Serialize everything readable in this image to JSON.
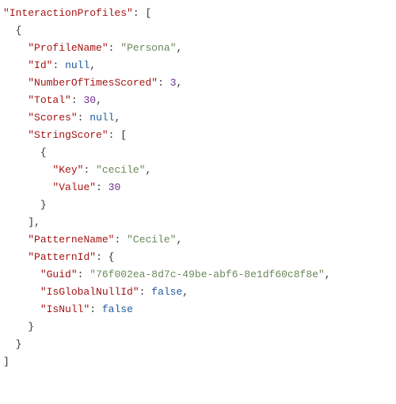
{
  "json": {
    "rootKey": "InteractionProfiles",
    "profileName": {
      "key": "ProfileName",
      "value": "Persona"
    },
    "id": {
      "key": "Id",
      "value": "null"
    },
    "numScored": {
      "key": "NumberOfTimesScored",
      "value": "3"
    },
    "total": {
      "key": "Total",
      "value": "30"
    },
    "scores": {
      "key": "Scores",
      "value": "null"
    },
    "stringScore": {
      "key": "StringScore",
      "item": {
        "keyField": {
          "key": "Key",
          "value": "cecile"
        },
        "valueField": {
          "key": "Value",
          "value": "30"
        }
      }
    },
    "patternName": {
      "key": "PatterneName",
      "value": "Cecile"
    },
    "patternId": {
      "key": "PatternId",
      "guid": {
        "key": "Guid",
        "value": "76f002ea-8d7c-49be-abf6-8e1df60c8f8e"
      },
      "globalN": {
        "key": "IsGlobalNullId",
        "value": "false"
      },
      "isNull": {
        "key": "IsNull",
        "value": "false"
      }
    }
  },
  "chart_data": {
    "type": "table",
    "title": "JSON snippet — InteractionProfiles[0]",
    "data": {
      "InteractionProfiles": [
        {
          "ProfileName": "Persona",
          "Id": null,
          "NumberOfTimesScored": 3,
          "Total": 30,
          "Scores": null,
          "StringScore": [
            {
              "Key": "cecile",
              "Value": 30
            }
          ],
          "PatterneName": "Cecile",
          "PatternId": {
            "Guid": "76f002ea-8d7c-49be-abf6-8e1df60c8f8e",
            "IsGlobalNullId": false,
            "IsNull": false
          }
        }
      ]
    }
  }
}
